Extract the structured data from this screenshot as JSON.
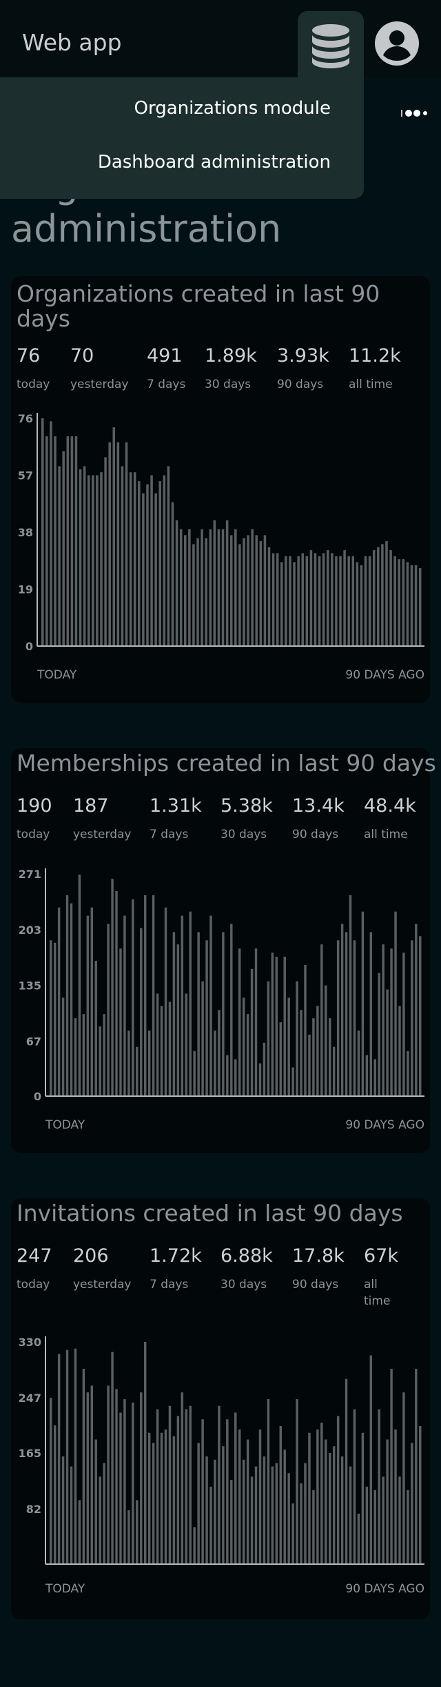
{
  "app": {
    "title": "Web app",
    "icons": {
      "database": "database-icon",
      "account": "account-circle-icon",
      "more": "more-horizontal-icon"
    }
  },
  "menu": {
    "items": [
      {
        "label": "Organizations module"
      },
      {
        "label": "Dashboard administration"
      }
    ]
  },
  "page": {
    "heading_ghost": "Organizations",
    "heading": "administration"
  },
  "colors": {
    "background": "#021116",
    "card": "#020709",
    "bar": "#5a5f61",
    "menu": "#1c2e2e"
  },
  "cards": [
    {
      "title": "Organizations created in last 90 days",
      "stats": [
        {
          "value": "76",
          "label": "today"
        },
        {
          "value": "70",
          "label": "yesterday"
        },
        {
          "value": "491",
          "label": "7 days"
        },
        {
          "value": "1.89k",
          "label": "30 days"
        },
        {
          "value": "3.93k",
          "label": "90 days"
        },
        {
          "value": "11.2k",
          "label": "all time"
        }
      ],
      "x_start": "TODAY",
      "x_end": "90 DAYS AGO"
    },
    {
      "title": "Memberships created in last 90 days",
      "stats": [
        {
          "value": "190",
          "label": "today"
        },
        {
          "value": "187",
          "label": "yesterday"
        },
        {
          "value": "1.31k",
          "label": "7 days"
        },
        {
          "value": "5.38k",
          "label": "30 days"
        },
        {
          "value": "13.4k",
          "label": "90 days"
        },
        {
          "value": "48.4k",
          "label": "all time"
        }
      ],
      "x_start": "TODAY",
      "x_end": "90 DAYS AGO"
    },
    {
      "title": "Invitations created in last 90 days",
      "stats": [
        {
          "value": "247",
          "label": "today"
        },
        {
          "value": "206",
          "label": "yesterday"
        },
        {
          "value": "1.72k",
          "label": "7 days"
        },
        {
          "value": "6.88k",
          "label": "30 days"
        },
        {
          "value": "17.8k",
          "label": "90 days"
        },
        {
          "value": "67k",
          "label": "all time"
        }
      ],
      "x_start": "TODAY",
      "x_end": "90 DAYS AGO"
    }
  ],
  "chart_data": [
    {
      "type": "bar",
      "title": "Organizations created in last 90 days",
      "x_start_label": "TODAY",
      "x_end_label": "90 DAYS AGO",
      "yticks": [
        0,
        19,
        38,
        57,
        76
      ],
      "ylim": [
        0,
        76
      ],
      "grid": false,
      "values": [
        76,
        70,
        75,
        70,
        60,
        65,
        70,
        70,
        70,
        59,
        60,
        57,
        57,
        57,
        58,
        63,
        68,
        73,
        68,
        60,
        68,
        58,
        58,
        55,
        51,
        54,
        57,
        51,
        55,
        57,
        60,
        48,
        42,
        39,
        37,
        39,
        34,
        36,
        39,
        36,
        39,
        42,
        39,
        39,
        42,
        37,
        39,
        34,
        36,
        37,
        39,
        37,
        35,
        37,
        33,
        31,
        31,
        28,
        30,
        30,
        28,
        30,
        31,
        30,
        32,
        31,
        30,
        31,
        32,
        31,
        30,
        30,
        32,
        30,
        30,
        28,
        27,
        30,
        30,
        32,
        33,
        34,
        35,
        32,
        30,
        29,
        29,
        28,
        27,
        27,
        26
      ]
    },
    {
      "type": "bar",
      "title": "Memberships created in last 90 days",
      "x_start_label": "TODAY",
      "x_end_label": "90 DAYS AGO",
      "yticks": [
        0,
        67,
        135,
        203,
        271
      ],
      "ylim": [
        0,
        271
      ],
      "grid": false,
      "values": [
        190,
        187,
        230,
        120,
        245,
        235,
        95,
        270,
        100,
        220,
        230,
        165,
        85,
        100,
        210,
        265,
        250,
        180,
        220,
        80,
        240,
        60,
        205,
        245,
        80,
        245,
        125,
        110,
        230,
        115,
        200,
        185,
        220,
        125,
        225,
        55,
        200,
        140,
        190,
        220,
        80,
        105,
        200,
        50,
        210,
        45,
        180,
        120,
        100,
        155,
        180,
        40,
        65,
        140,
        175,
        170,
        90,
        170,
        120,
        35,
        140,
        105,
        160,
        75,
        95,
        110,
        185,
        135,
        95,
        60,
        190,
        210,
        200,
        245,
        190,
        80,
        225,
        50,
        200,
        45,
        150,
        185,
        130,
        180,
        225,
        110,
        175,
        55,
        190,
        210,
        195
      ]
    },
    {
      "type": "bar",
      "title": "Invitations created in last 90 days",
      "x_start_label": "TODAY",
      "x_end_label": "90 DAYS AGO",
      "yticks": [
        82,
        165,
        247,
        330
      ],
      "ylim": [
        0,
        330
      ],
      "grid": false,
      "values": [
        247,
        206,
        312,
        160,
        318,
        145,
        320,
        95,
        290,
        255,
        265,
        185,
        130,
        150,
        265,
        315,
        260,
        225,
        245,
        80,
        240,
        95,
        255,
        330,
        195,
        180,
        230,
        195,
        200,
        235,
        190,
        220,
        255,
        230,
        235,
        55,
        180,
        215,
        160,
        115,
        155,
        235,
        175,
        215,
        125,
        225,
        200,
        155,
        185,
        130,
        145,
        200,
        160,
        245,
        145,
        150,
        205,
        170,
        135,
        90,
        245,
        120,
        150,
        195,
        110,
        200,
        210,
        185,
        165,
        175,
        220,
        160,
        275,
        145,
        230,
        75,
        195,
        115,
        310,
        110,
        230,
        130,
        185,
        290,
        200,
        130,
        255,
        110,
        180,
        290,
        205
      ]
    }
  ]
}
